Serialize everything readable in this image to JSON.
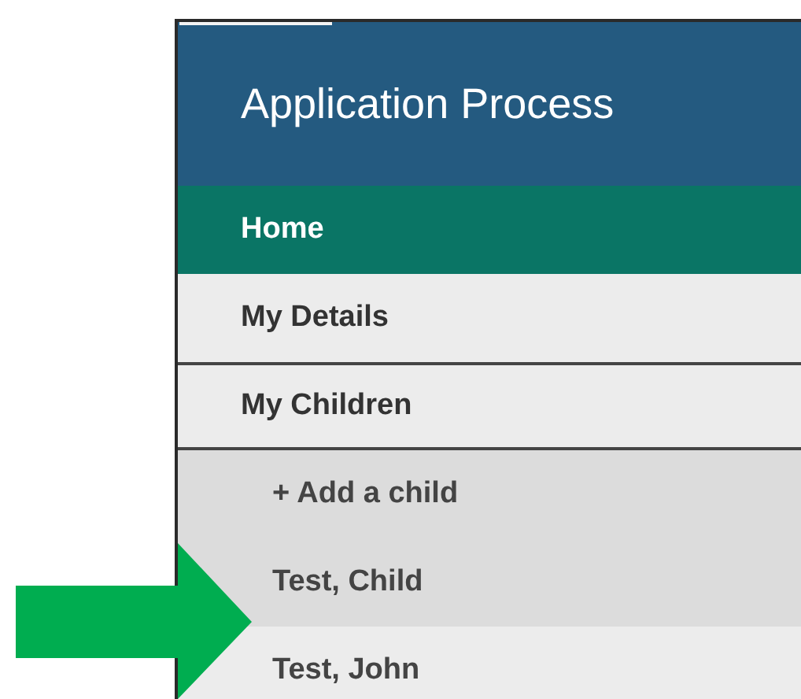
{
  "header": {
    "title": "Application Process"
  },
  "nav": [
    {
      "label": "Home",
      "selected": true,
      "kind": "link"
    },
    {
      "label": "My Details",
      "selected": false,
      "kind": "link"
    },
    {
      "label": "My Children",
      "selected": false,
      "kind": "group",
      "expanded": true,
      "children": [
        {
          "label": "+ Add a child",
          "highlighted": false
        },
        {
          "label": "Test, Child",
          "highlighted": false
        },
        {
          "label": "Test, John",
          "highlighted": true
        }
      ]
    }
  ]
}
